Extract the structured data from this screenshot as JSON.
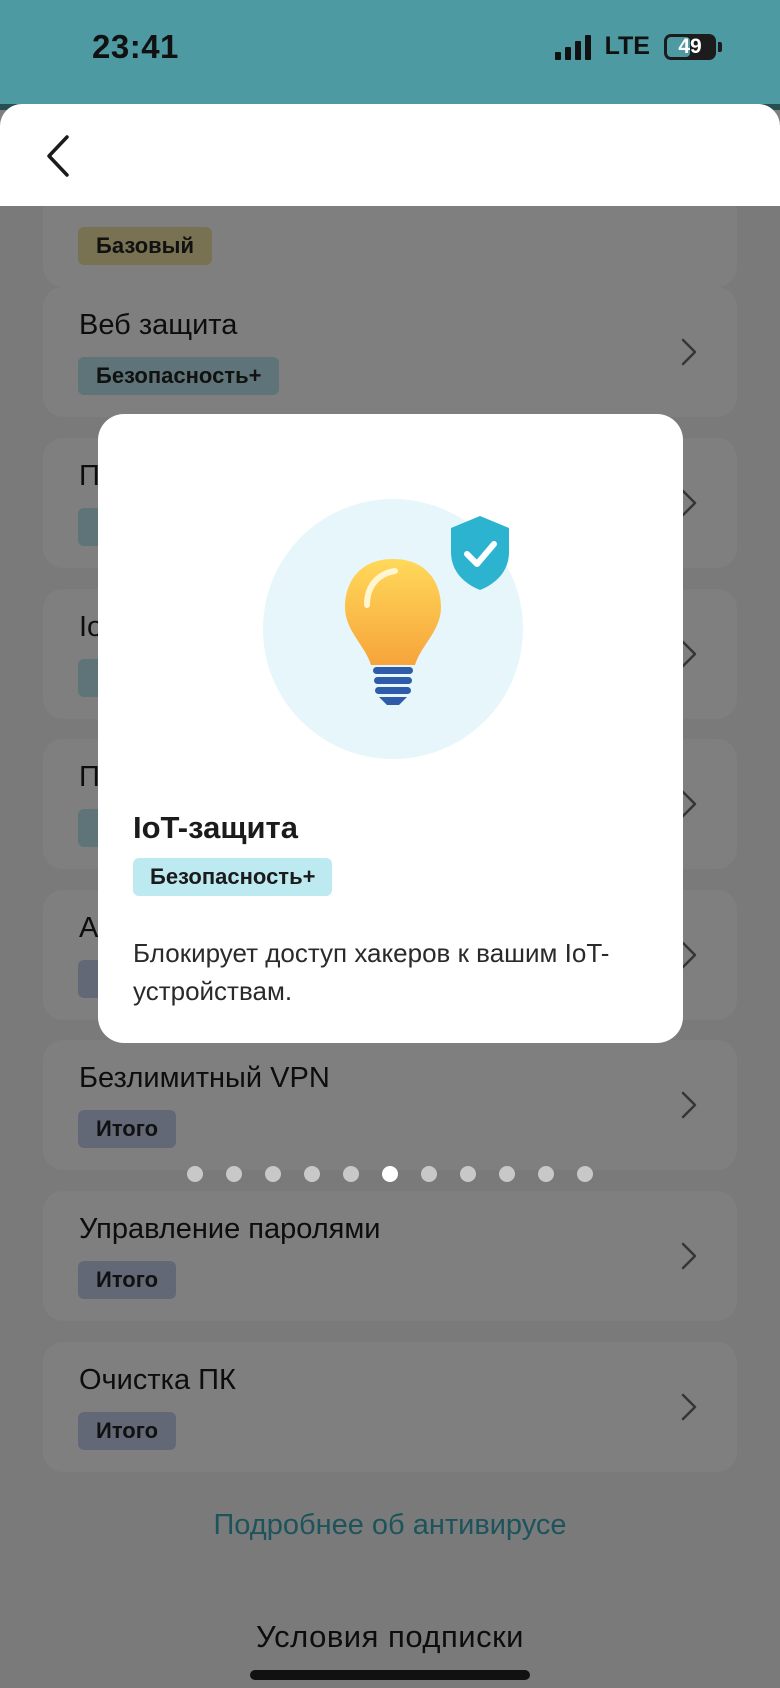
{
  "status_bar": {
    "time": "23:41",
    "network": "LTE",
    "battery_percent": "49",
    "battery_level": 0.49,
    "signal_bars": 4
  },
  "header": {
    "back_icon": "chevron-left-icon"
  },
  "features": [
    {
      "title": "",
      "badge": "Базовый",
      "badge_color": "#f1e4a5"
    },
    {
      "title": "Веб защита",
      "badge": "Безопасность+",
      "badge_color": "#bde9f0"
    },
    {
      "title": "П",
      "badge": "",
      "badge_color": "#bde9f0"
    },
    {
      "title": "Io",
      "badge": "",
      "badge_color": "#bde9f0"
    },
    {
      "title": "П",
      "badge": "",
      "badge_color": "#bde9f0"
    },
    {
      "title": "А",
      "badge": "",
      "badge_color": "#c7d1ef"
    },
    {
      "title": "Безлимитный VPN",
      "badge": "Итого",
      "badge_color": "#c7d1ef"
    },
    {
      "title": "Управление паролями",
      "badge": "Итого",
      "badge_color": "#c7d1ef"
    },
    {
      "title": "Очистка ПК",
      "badge": "Итого",
      "badge_color": "#c7d1ef"
    }
  ],
  "links": {
    "more_about_antivirus": "Подробнее об антивирусе",
    "subscription_terms": "Условия подписки"
  },
  "dialog": {
    "illustration_icon": "lightbulb-icon",
    "shield_icon": "shield-check-icon",
    "title": "IoT-защита",
    "badge": "Безопасность+",
    "description": "Блокирует доступ хакеров к вашим IoT-устройствам."
  },
  "pager": {
    "total": 11,
    "active_index": 5
  },
  "colors": {
    "accent": "#3ba9b8",
    "status_bar": "#4e9aa3",
    "badge_basic": "#f1e4a5",
    "badge_security": "#bde9f0",
    "badge_total": "#c7d1ef"
  }
}
